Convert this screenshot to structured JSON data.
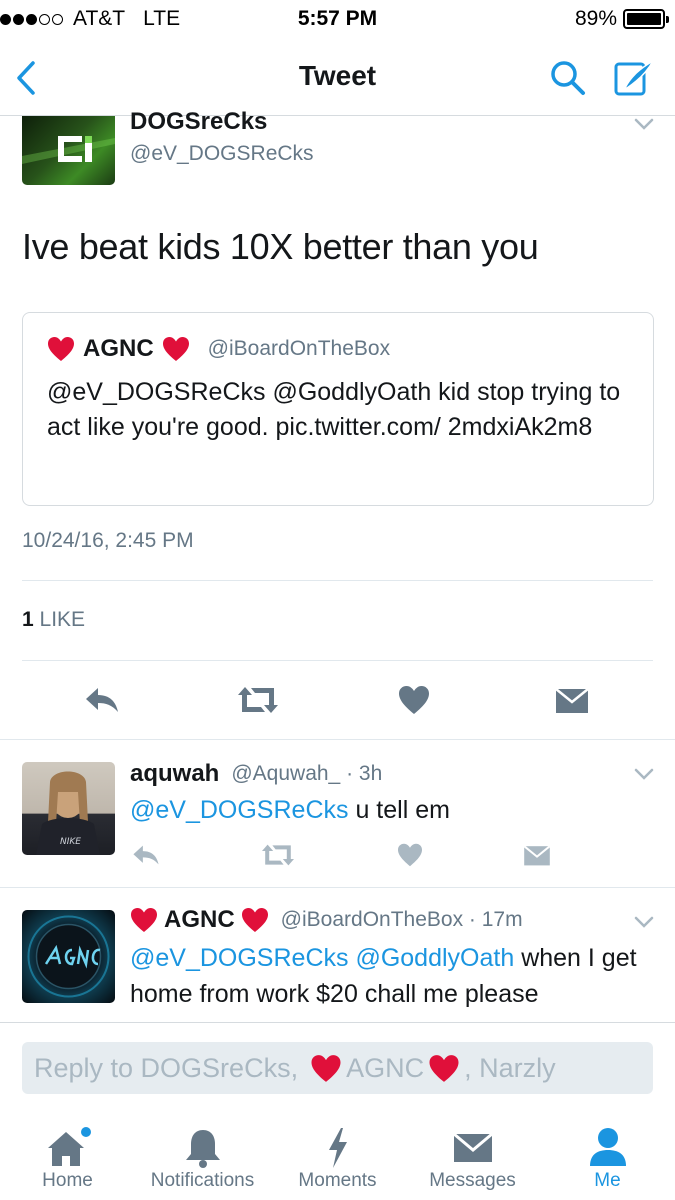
{
  "status_bar": {
    "carrier": "AT&T",
    "network": "LTE",
    "time": "5:57 PM",
    "battery": "89%"
  },
  "nav": {
    "title": "Tweet",
    "back_icon": "chevron-left-icon",
    "search_icon": "search-icon",
    "compose_icon": "compose-icon"
  },
  "tweet": {
    "author_name": "DOGSreCks",
    "author_handle": "@eV_DOGSReCks",
    "text": "Ive beat kids 10X better than you",
    "quoted": {
      "name": "AGNC",
      "handle": "@iBoardOnTheBox",
      "text_mentions": "@eV_DOGSReCks @GoddlyOath",
      "text_rest": " kid stop trying to act like you're good. pic.twitter.com/ 2mdxiAk2m8"
    },
    "timestamp": "10/24/16, 2:45 PM",
    "like_count": "1",
    "like_label": "LIKE"
  },
  "replies": [
    {
      "name": "aquwah",
      "meta": "@Aquwah_ · 3h",
      "mentions": "@eV_DOGSReCks",
      "text": " u tell em"
    },
    {
      "name": "AGNC",
      "meta": "@iBoardOnTheBox · 17m",
      "mention_1": "@eV_DOGSReCks",
      "mention_2": "@GoddlyOath",
      "text": " when I get home from work $20 chall me please"
    }
  ],
  "composer": {
    "prefix": "Reply to DOGSreCks,",
    "middle": "AGNC",
    "suffix": ", Narzly"
  },
  "tabs": [
    {
      "label": "Home",
      "icon": "home-icon"
    },
    {
      "label": "Notifications",
      "icon": "bell-icon"
    },
    {
      "label": "Moments",
      "icon": "lightning-icon"
    },
    {
      "label": "Messages",
      "icon": "envelope-icon"
    },
    {
      "label": "Me",
      "icon": "person-icon"
    }
  ],
  "colors": {
    "accent": "#1b95e0",
    "muted": "#657786",
    "heart": "#e0245e"
  }
}
